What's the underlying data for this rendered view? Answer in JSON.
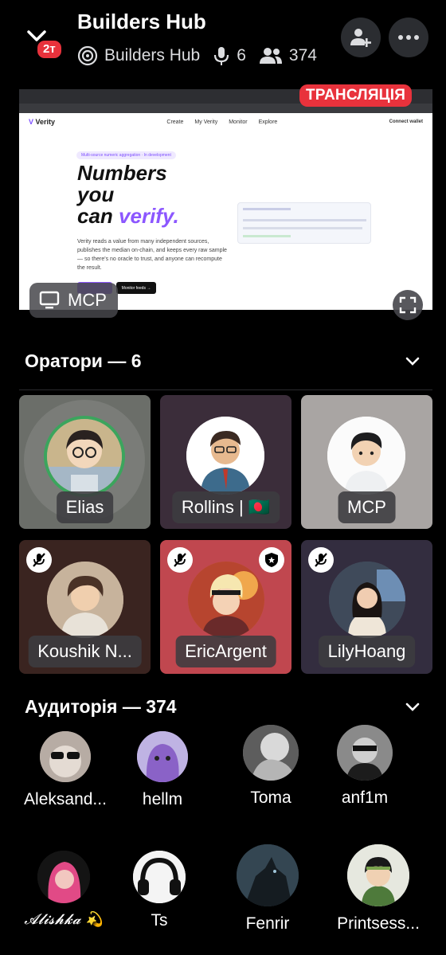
{
  "header": {
    "title": "Builders Hub",
    "server_name": "Builders Hub",
    "badge": "2т",
    "speaker_count": "6",
    "listener_count": "374"
  },
  "stream": {
    "live_label": "ТРАНСЛЯЦІЯ",
    "screen_owner": "MCP",
    "site": {
      "logo": "Verity",
      "nav": [
        "Create",
        "My Verity",
        "Monitor",
        "Explore"
      ],
      "connect": "Connect wallet",
      "pill": "Multi-source numeric aggregation · In development",
      "hero_line1": "Numbers",
      "hero_line2": "you",
      "hero_line3a": "can ",
      "hero_line3b": "verify.",
      "description": "Verity reads a value from many independent sources, publishes the median on-chain, and keeps every raw sample — so there's no oracle to trust, and anyone can recompute the result.",
      "monitor_btn": "Monitor feeds →"
    }
  },
  "speakers_section": {
    "title": "Оратори — 6"
  },
  "speakers": [
    {
      "name": "Elias",
      "muted": false,
      "speaking": true
    },
    {
      "name": "Rollins | 🇧🇩",
      "muted": false,
      "speaking": false
    },
    {
      "name": "MCP",
      "muted": false,
      "speaking": false
    },
    {
      "name": "Koushik N...",
      "muted": true,
      "speaking": false
    },
    {
      "name": "EricArgent",
      "muted": true,
      "speaking": false,
      "moderator": true
    },
    {
      "name": "LilyHoang",
      "muted": true,
      "speaking": false
    }
  ],
  "audience_section": {
    "title": "Аудиторія — 374"
  },
  "audience": [
    {
      "name": "Aleksand..."
    },
    {
      "name": "hellm"
    },
    {
      "name": "Toma"
    },
    {
      "name": "anf1m"
    },
    {
      "name": "𝓐𝓵𝓲𝓼𝓱𝓴𝓪 💫"
    },
    {
      "name": "Ts"
    },
    {
      "name": "Fenrir"
    },
    {
      "name": "Printsess..."
    }
  ],
  "colors": {
    "background": "#000000",
    "live_red": "#e8323c",
    "speaking_ring": "#3ba55d",
    "tile_elias": "#6b6e69",
    "tile_rollins": "#3b2d3a",
    "tile_mcp": "#a9a5a3",
    "tile_koushik": "#3a2420",
    "tile_eric": "#c0474f",
    "tile_lily": "#332d3f"
  }
}
